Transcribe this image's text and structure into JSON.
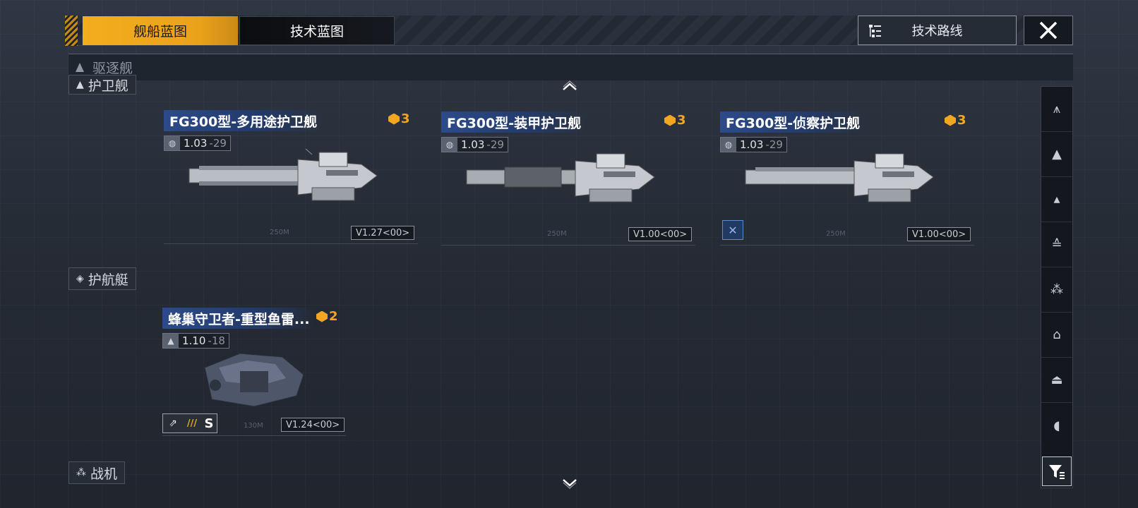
{
  "tabs": [
    {
      "label": "舰船蓝图",
      "active": true
    },
    {
      "label": "技术蓝图",
      "active": false
    }
  ],
  "route_button": {
    "label": "技术路线"
  },
  "category_bar": {
    "label": "驱逐舰"
  },
  "sections": {
    "escort": "护卫舰",
    "corvette": "护航艇",
    "fighter": "战机"
  },
  "cards": [
    {
      "title": "FG300型-多用途护卫舰",
      "cost": "3",
      "version": "1.03",
      "sub_version": "-29",
      "scale": "250M",
      "bp_version": "V1.27<00>"
    },
    {
      "title": "FG300型-装甲护卫舰",
      "cost": "3",
      "version": "1.03",
      "sub_version": "-29",
      "scale": "250M",
      "bp_version": "V1.00<00>"
    },
    {
      "title": "FG300型-侦察护卫舰",
      "cost": "3",
      "version": "1.03",
      "sub_version": "-29",
      "scale": "250M",
      "bp_version": "V1.00<00>"
    },
    {
      "title": "蜂巢守卫者-重型鱼雷...",
      "cost": "2",
      "version": "1.10",
      "sub_version": "-18",
      "scale": "130M",
      "bp_version": "V1.24<00>",
      "rank_stripes": "///",
      "rank_grade": "S"
    }
  ],
  "icons": {
    "route": "tree-list-icon",
    "close": "close-icon",
    "scroll_up": "chevron-up-icon",
    "scroll_down": "chevron-down-icon",
    "filter": "filter-icon",
    "cost": "blueprint-gem-icon"
  },
  "colors": {
    "accent": "#f3ad1d",
    "title_blue": "#2c4b8a",
    "cost": "#f3a622"
  }
}
